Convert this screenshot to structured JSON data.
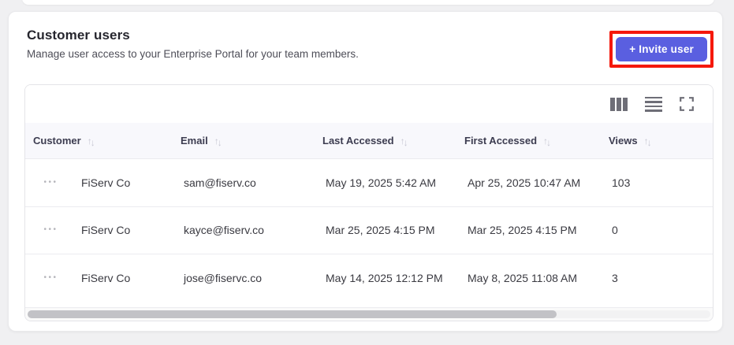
{
  "header": {
    "title": "Customer users",
    "subtitle": "Manage user access to your Enterprise Portal for your team members.",
    "invite_button_label": "+ Invite user"
  },
  "colors": {
    "accent": "#5a5fe0",
    "annotation_highlight": "#f5180b",
    "table_header_bg": "#f8f8fc",
    "page_bg": "#f0f0f2"
  },
  "icons": {
    "toolbar": [
      "columns-icon",
      "row-density-icon",
      "fullscreen-icon"
    ],
    "sort_up": "↑",
    "sort_down": "↓",
    "row_menu": "•••"
  },
  "table": {
    "columns": [
      {
        "label": "Customer"
      },
      {
        "label": "Email"
      },
      {
        "label": "Last Accessed"
      },
      {
        "label": "First Accessed"
      },
      {
        "label": "Views"
      }
    ],
    "rows": [
      {
        "customer": "FiServ Co",
        "email": "sam@fiserv.co",
        "last_accessed": "May 19, 2025 5:42 AM",
        "first_accessed": "Apr 25, 2025 10:47 AM",
        "views": "103"
      },
      {
        "customer": "FiServ Co",
        "email": "kayce@fiserv.co",
        "last_accessed": "Mar 25, 2025 4:15 PM",
        "first_accessed": "Mar 25, 2025 4:15 PM",
        "views": "0"
      },
      {
        "customer": "FiServ Co",
        "email": "jose@fiservc.co",
        "last_accessed": "May 14, 2025 12:12 PM",
        "first_accessed": "May 8, 2025 11:08 AM",
        "views": "3"
      }
    ]
  }
}
